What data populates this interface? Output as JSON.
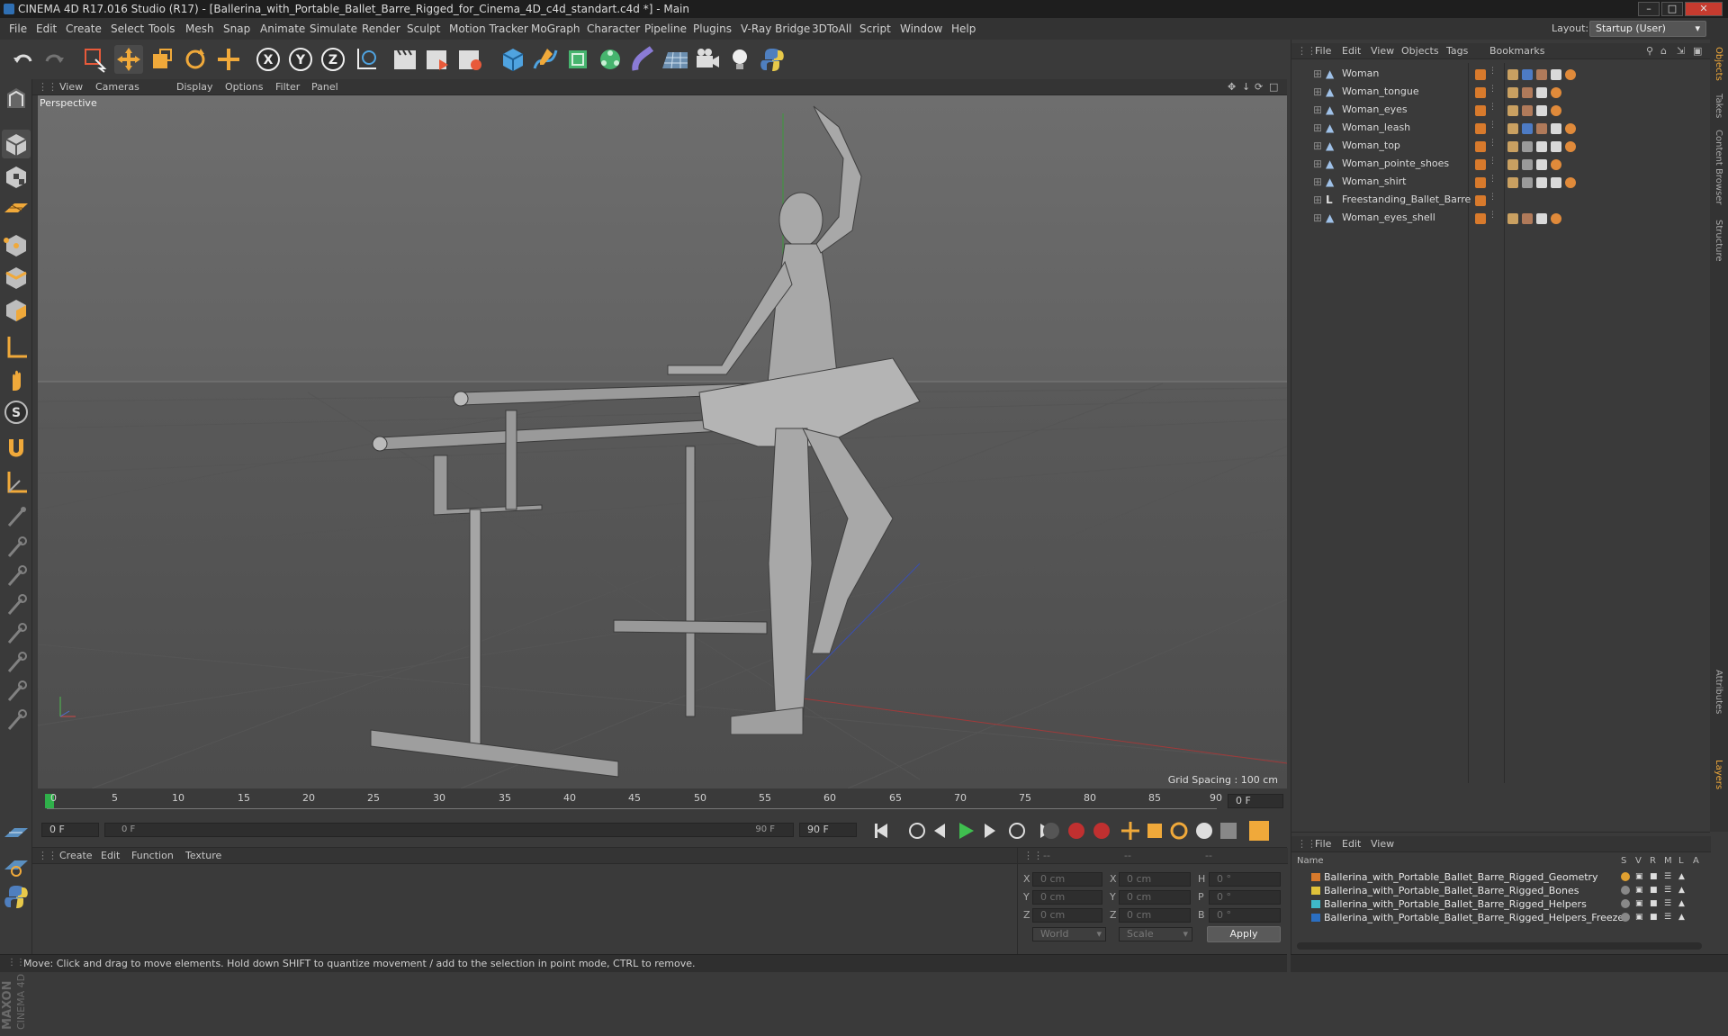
{
  "window": {
    "title": "CINEMA 4D R17.016 Studio (R17) - [Ballerina_with_Portable_Ballet_Barre_Rigged_for_Cinema_4D_c4d_standart.c4d *] - Main",
    "controls": [
      "–",
      "□",
      "✕"
    ]
  },
  "menubar": {
    "items": [
      "File",
      "Edit",
      "Create",
      "Select",
      "Tools",
      "Mesh",
      "Snap",
      "Animate",
      "Simulate",
      "Render",
      "Sculpt",
      "Motion Tracker",
      "MoGraph",
      "Character",
      "Pipeline",
      "Plugins",
      "V-Ray Bridge",
      "3DToAll",
      "Script",
      "Window",
      "Help"
    ],
    "layout_label": "Layout:",
    "layout_value": "Startup (User)"
  },
  "toolbar": {
    "axis_x": "X",
    "axis_y": "Y",
    "axis_z": "Z"
  },
  "left_toolbar": {
    "icons": [
      "model-mode-icon",
      "object-mode-icon",
      "texture-mode-icon",
      "workplane-icon",
      "points-mode-icon",
      "edges-mode-icon",
      "polygons-mode-icon",
      "axis-mode-icon",
      "tweak-icon",
      "soft-selection-icon",
      "magnet-icon",
      "axis-tool-icon",
      "joint-icon",
      "paint-icon",
      "weight-icon",
      "brush-icon",
      "brush-icon",
      "brush-icon",
      "brush-icon",
      "brush-icon",
      "snap-icon",
      "lock-icon",
      "python-icon"
    ]
  },
  "viewport": {
    "menu": [
      "View",
      "Cameras",
      "Display",
      "Options",
      "Filter",
      "Panel"
    ],
    "label": "Perspective",
    "grid_spacing": "Grid Spacing : 100 cm"
  },
  "timeline": {
    "ticks": [
      "0",
      "5",
      "10",
      "15",
      "20",
      "25",
      "30",
      "35",
      "40",
      "45",
      "50",
      "55",
      "60",
      "65",
      "70",
      "75",
      "80",
      "85",
      "90"
    ],
    "current_frame_right": "0 F",
    "start_frame": "0 F",
    "range_start": "0 F",
    "range_end": "90 F",
    "end_frame": "90 F"
  },
  "material_manager": {
    "menu": [
      "Create",
      "Edit",
      "Function",
      "Texture"
    ]
  },
  "coordinates": {
    "header": [
      "--",
      "--",
      "--"
    ],
    "rows": [
      {
        "axis": "X",
        "pos": "0 cm",
        "axis2": "X",
        "size": "0 cm",
        "rot_label": "H",
        "rot": "0 °"
      },
      {
        "axis": "Y",
        "pos": "0 cm",
        "axis2": "Y",
        "size": "0 cm",
        "rot_label": "P",
        "rot": "0 °"
      },
      {
        "axis": "Z",
        "pos": "0 cm",
        "axis2": "Z",
        "size": "0 cm",
        "rot_label": "B",
        "rot": "0 °"
      }
    ],
    "mode1": "World",
    "mode2": "Scale",
    "apply_label": "Apply"
  },
  "object_manager": {
    "menu": [
      "File",
      "Edit",
      "View",
      "Objects",
      "Tags",
      "Bookmarks"
    ],
    "objects": [
      {
        "name": "Woman",
        "type": "bone"
      },
      {
        "name": "Woman_tongue",
        "type": "bone"
      },
      {
        "name": "Woman_eyes",
        "type": "bone"
      },
      {
        "name": "Woman_leash",
        "type": "bone"
      },
      {
        "name": "Woman_top",
        "type": "bone"
      },
      {
        "name": "Woman_pointe_shoes",
        "type": "bone"
      },
      {
        "name": "Woman_shirt",
        "type": "bone"
      },
      {
        "name": "Freestanding_Ballet_Barre",
        "type": "null"
      },
      {
        "name": "Woman_eyes_shell",
        "type": "bone"
      }
    ],
    "side_tabs": [
      "Objects",
      "Takes",
      "Content Browser",
      "Structure"
    ]
  },
  "layer_manager": {
    "menu": [
      "File",
      "Edit",
      "View"
    ],
    "columns": [
      "Name",
      "S",
      "V",
      "R",
      "M",
      "L",
      "A"
    ],
    "layers": [
      {
        "name": "Ballerina_with_Portable_Ballet_Barre_Rigged_Geometry",
        "color": "#d87a2c"
      },
      {
        "name": "Ballerina_with_Portable_Ballet_Barre_Rigged_Bones",
        "color": "#e0c23a"
      },
      {
        "name": "Ballerina_with_Portable_Ballet_Barre_Rigged_Helpers",
        "color": "#3fb9c9"
      },
      {
        "name": "Ballerina_with_Portable_Ballet_Barre_Rigged_Helpers_Freeze",
        "color": "#2b6fc2"
      }
    ],
    "side_tabs": [
      "Attributes",
      "Layers"
    ]
  },
  "statusbar": {
    "text": "Move: Click and drag to move elements. Hold down SHIFT to quantize movement / add to the selection in point mode, CTRL to remove."
  },
  "brand": {
    "logo_text": "MAXON CINEMA 4D"
  }
}
